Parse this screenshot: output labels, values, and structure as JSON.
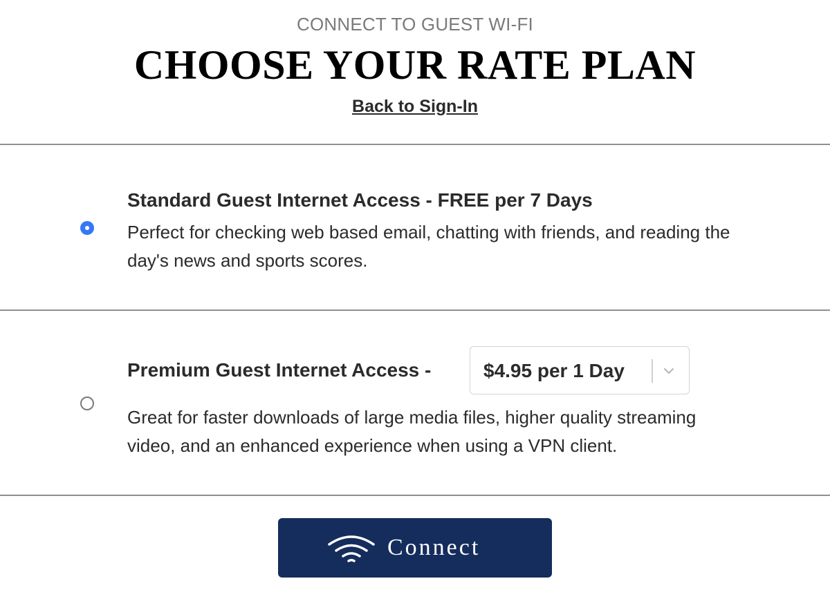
{
  "header": {
    "subtitle": "CONNECT TO GUEST WI-FI",
    "title": "CHOOSE YOUR RATE PLAN",
    "back_link": "Back to Sign-In"
  },
  "plans": [
    {
      "title": "Standard Guest Internet Access - FREE per 7 Days",
      "description": "Perfect for checking web based email, chatting with friends, and reading the day's news and sports scores.",
      "selected": true
    },
    {
      "title": "Premium Guest Internet Access -",
      "description": "Great for faster downloads of large media files, higher quality streaming video, and an enhanced experience when using a VPN client.",
      "selected": false,
      "rate_select": {
        "value": "$4.95 per 1 Day"
      }
    }
  ],
  "connect_button": {
    "label": "Connect",
    "icon": "wifi-icon"
  },
  "colors": {
    "accent_radio": "#3478f6",
    "button_bg": "#152d5c",
    "divider": "#8f8f8f"
  }
}
